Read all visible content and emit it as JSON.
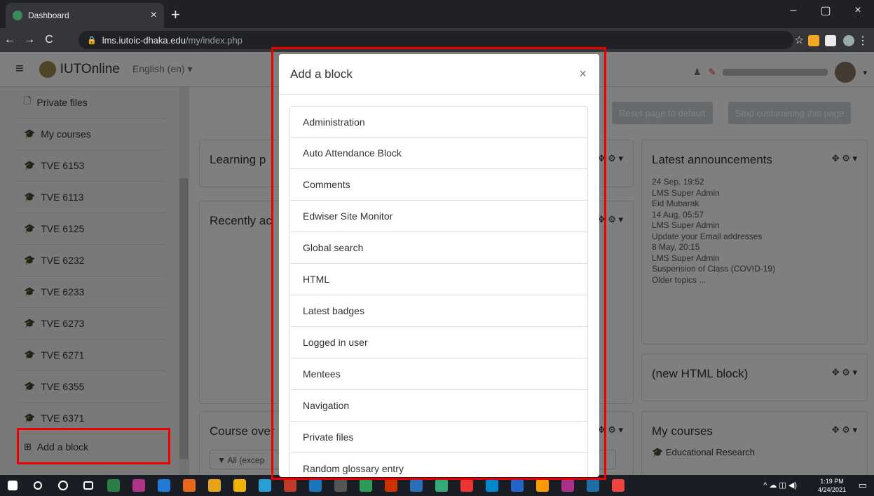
{
  "browser": {
    "tab_title": "Dashboard",
    "tab_close": "×",
    "new_tab": "+",
    "url_host": "lms.iutoic-dhaka.edu",
    "url_path": "/my/index.php",
    "win_min": "–",
    "win_max": "▢",
    "win_close": "×"
  },
  "navbar": {
    "brand": "IUTOnline",
    "language": "English (en) ▾"
  },
  "drawer": {
    "items": [
      "Private files",
      "My courses",
      "TVE 6153",
      "TVE 6113",
      "TVE 6125",
      "TVE 6232",
      "TVE 6233",
      "TVE 6273",
      "TVE 6271",
      "TVE 6355",
      "TVE 6371"
    ],
    "add_block": "Add a block"
  },
  "actions": {
    "reset": "Reset page to default",
    "stop": "Stop customising this page"
  },
  "blocks": {
    "learning": "Learning p",
    "recent": "Recently ac",
    "course_overview": "Course over",
    "filter": "▼ All (excep",
    "latest_announcements": "Latest announcements",
    "new_html": "(new HTML block)",
    "my_courses": "My courses",
    "my_courses_item": "Educational Research",
    "controls": "✥ ⚙ ▾",
    "announcements": [
      "24 Sep, 19:52",
      "LMS Super Admin",
      "Eid Mubarak",
      "14 Aug, 05:57",
      "LMS Super Admin",
      "Update your Email addresses",
      "8 May, 20:15",
      "LMS Super Admin",
      "Suspension of Class (COVID-19)",
      "Older topics ..."
    ]
  },
  "modal": {
    "title": "Add a block",
    "close": "×",
    "items": [
      "Administration",
      "Auto Attendance Block",
      "Comments",
      "Edwiser Site Monitor",
      "Global search",
      "HTML",
      "Latest badges",
      "Logged in user",
      "Mentees",
      "Navigation",
      "Private files",
      "Random glossary entry"
    ]
  },
  "taskbar": {
    "time": "1:19 PM",
    "date": "4/24/2021",
    "colors": [
      "#2d7d46",
      "#b0338a",
      "#1f7ad8",
      "#e8681a",
      "#e8a317",
      "#f2b200",
      "#2a9fd6",
      "#c0392b",
      "#1b75bc",
      "#555",
      "#2d9c5a",
      "#cc3300",
      "#2a6ebb",
      "#3a7",
      "#e33",
      "#08c",
      "#26c",
      "#f90",
      "#aa2e8a",
      "#1d6fa5",
      "#e44"
    ]
  }
}
